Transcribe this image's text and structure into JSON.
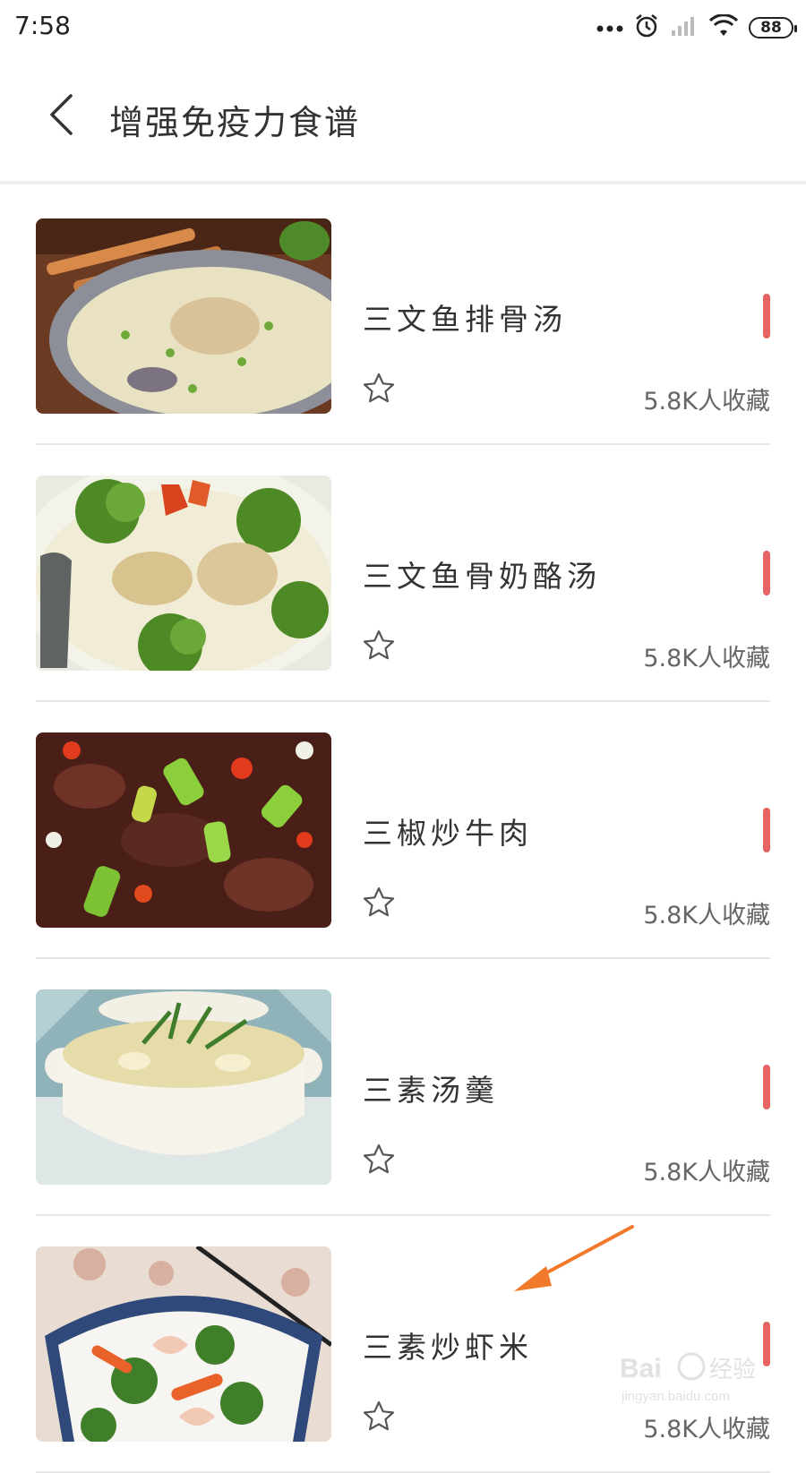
{
  "status_bar": {
    "time": "7:58",
    "battery": "88"
  },
  "header": {
    "title": "增强免疫力食谱"
  },
  "recipes": [
    {
      "title": "三文鱼排骨汤",
      "favorites": "5.8K人收藏"
    },
    {
      "title": "三文鱼骨奶酪汤",
      "favorites": "5.8K人收藏"
    },
    {
      "title": "三椒炒牛肉",
      "favorites": "5.8K人收藏"
    },
    {
      "title": "三素汤羹",
      "favorites": "5.8K人收藏"
    },
    {
      "title": "三素炒虾米",
      "favorites": "5.8K人收藏"
    }
  ],
  "watermark": {
    "text": "Bai 经验",
    "url": "jingyan.baidu.com"
  },
  "colors": {
    "accent": "#e66363",
    "annotation": "#f07a2a",
    "divider": "#e6e6e6"
  }
}
